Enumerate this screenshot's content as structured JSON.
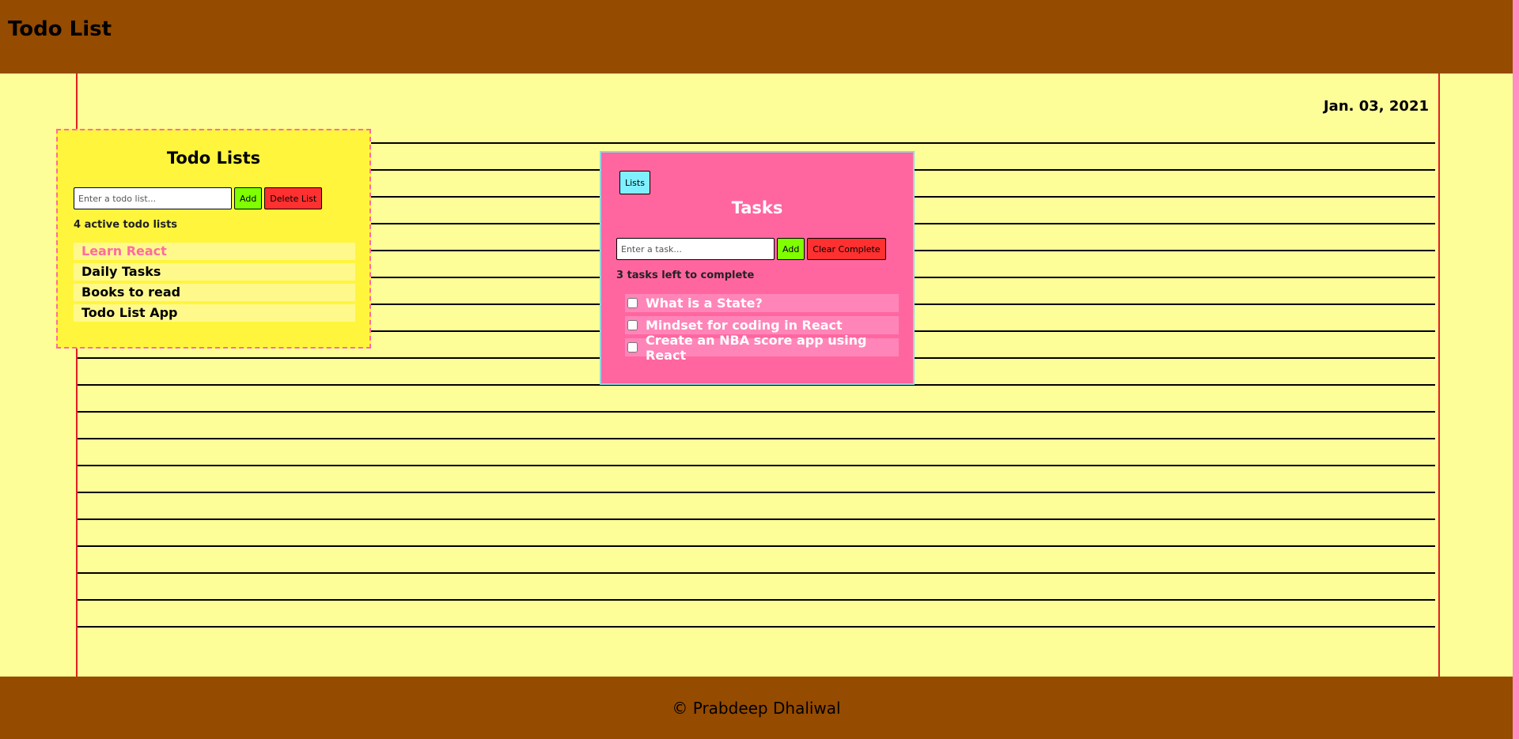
{
  "header": {
    "title": "Todo List"
  },
  "date": "Jan. 03, 2021",
  "lists_panel": {
    "title": "Todo Lists",
    "input_placeholder": "Enter a todo list...",
    "add_label": "Add",
    "delete_label": "Delete List",
    "count_text": "4 active todo lists",
    "items": [
      {
        "label": "Learn React"
      },
      {
        "label": "Daily Tasks"
      },
      {
        "label": "Books to read"
      },
      {
        "label": "Todo List App"
      }
    ]
  },
  "tasks_panel": {
    "lists_button": "Lists",
    "title": "Tasks",
    "input_placeholder": "Enter a task...",
    "add_label": "Add",
    "clear_label": "Clear Complete",
    "count_text": "3 tasks left to complete",
    "items": [
      {
        "label": "What is a State?"
      },
      {
        "label": "Mindset for coding in React"
      },
      {
        "label": "Create an NBA score app using React"
      }
    ]
  },
  "footer": {
    "text": "© Prabdeep Dhaliwal"
  },
  "colors": {
    "header_bg": "#954b00",
    "page_bg": "#fefe99",
    "lists_panel_bg": "#fff53d",
    "tasks_panel_bg": "#ff66a0",
    "accent_pink": "#ff6b9f"
  }
}
